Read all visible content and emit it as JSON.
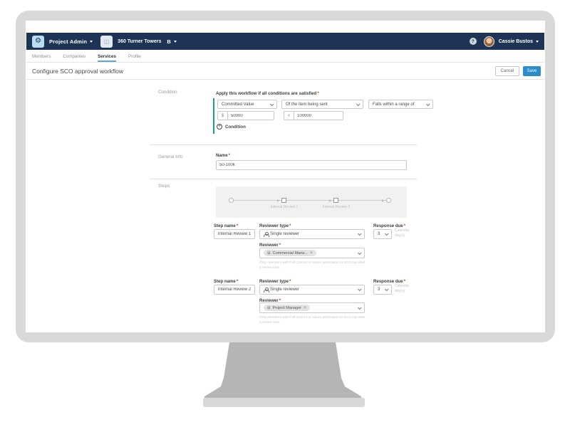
{
  "icons": {
    "gear": "⚙",
    "help": "?",
    "bookmark": "B",
    "plus": "+",
    "grid": "⊞",
    "close": "×",
    "building": "◫"
  },
  "colors": {
    "navbar": "#1d3456",
    "accent_blue": "#2a8dcc",
    "tab_underline": "#58a8d9",
    "condition_teal": "#14a199"
  },
  "navbar": {
    "app_menu": "Project Admin",
    "project": "360 Turner Towers",
    "user": "Cassie Bustos"
  },
  "tabs": [
    {
      "label": "Members"
    },
    {
      "label": "Companies"
    },
    {
      "label": "Services"
    },
    {
      "label": "Profile"
    }
  ],
  "header": {
    "title": "Configure SCO approval workflow",
    "cancel": "Cancel",
    "save": "Save"
  },
  "condition": {
    "section_label": "Condition",
    "apply_label": "Apply this workflow if all conditions are satisfied",
    "field": "Committed Value",
    "subject": "Of the item being sent",
    "operator": "Falls within a range of",
    "min_prefix": "$",
    "min_value": "50000",
    "max_prefix": "<",
    "max_value": "100000",
    "add_label": "Condition"
  },
  "general_info": {
    "section_label": "General Info",
    "name_label": "Name",
    "name_value": "50-100k"
  },
  "steps": {
    "section_label": "Steps",
    "diagram": {
      "labels": [
        "Internal Review 1",
        "Internal Review 2"
      ]
    },
    "forms": [
      {
        "step_name_label": "Step name",
        "step_name": "Internal Review 1",
        "reviewer_type_label": "Reviewer type",
        "reviewer_type": "Single reviewer",
        "response_due_label": "Response due",
        "response_due": "3",
        "response_unit": "Calendar day(s)",
        "reviewer_label": "Reviewer",
        "reviewer_chip": "Commercial Mana...",
        "hint": "Only members with Full Control or Admin permission to SCO can start a review task."
      },
      {
        "step_name_label": "Step name",
        "step_name": "Internal Review 2",
        "reviewer_type_label": "Reviewer type",
        "reviewer_type": "Single reviewer",
        "response_due_label": "Response due",
        "response_due": "3",
        "response_unit": "Calendar day(s)",
        "reviewer_label": "Reviewer",
        "reviewer_chip": "Project Manager",
        "hint": "Only members with Full Control or Admin permission to SCO can start a review task."
      }
    ]
  },
  "misc": {
    "asterisk": "*"
  }
}
